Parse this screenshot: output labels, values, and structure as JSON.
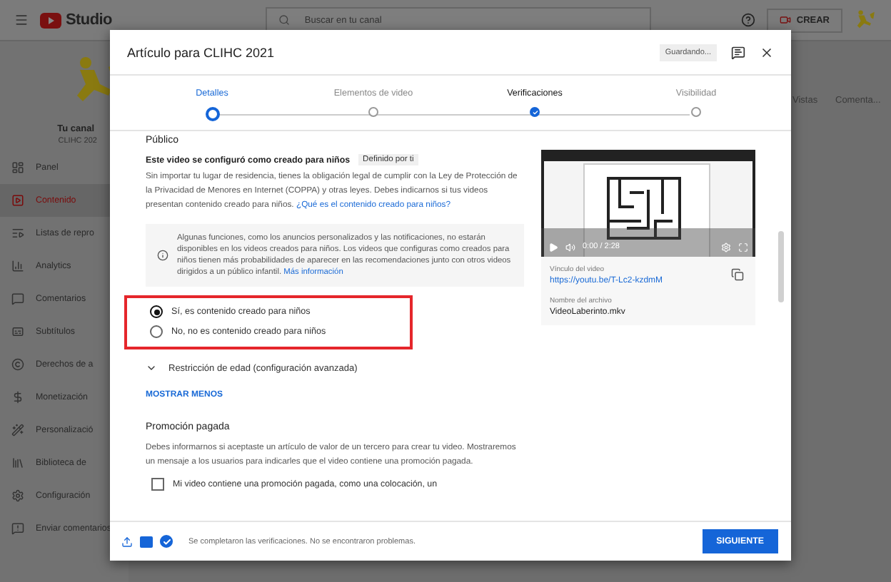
{
  "header": {
    "logo": "Studio",
    "search": {
      "placeholder": "Buscar en tu canal"
    },
    "create_button": "CREAR"
  },
  "sidebar": {
    "title": "Tu canal",
    "channel": "CLIHC  202",
    "items": [
      {
        "label": "Panel",
        "selected": false
      },
      {
        "label": "Contenido",
        "selected": true
      },
      {
        "label": "Listas de repro",
        "selected": false
      },
      {
        "label": "Analytics",
        "selected": false
      },
      {
        "label": "Comentarios",
        "selected": false
      },
      {
        "label": "Subtítulos",
        "selected": false
      },
      {
        "label": "Derechos de a",
        "selected": false
      },
      {
        "label": "Monetización",
        "selected": false
      },
      {
        "label": "Personalizació",
        "selected": false
      },
      {
        "label": "Biblioteca de",
        "selected": false
      },
      {
        "label": "Configuración",
        "selected": false
      },
      {
        "label": "Enviar comentarios",
        "selected": false
      }
    ]
  },
  "table": {
    "columns": [
      "Vistas",
      "Comenta..."
    ]
  },
  "dialog": {
    "title": "Artículo para CLIHC 2021",
    "save_status": "Guardando...",
    "steps": [
      {
        "label": "Detalles",
        "selected": true,
        "done": false
      },
      {
        "label": "Elementos de video",
        "selected": false,
        "done": false
      },
      {
        "label": "Verificaciones",
        "selected": false,
        "done": true
      },
      {
        "label": "Visibilidad",
        "selected": false,
        "done": false
      }
    ],
    "audience": {
      "heading": "Público",
      "subheading": "Este video se configuró como creado para niños",
      "chip": "Definido por ti",
      "description": "Sin importar tu lugar de residencia, tienes la obligación legal de cumplir con la Ley de Protección de la Privacidad de Menores en Internet (COPPA) y otras leyes. Debes indicarnos si tus videos presentan contenido creado para niños.",
      "description_link": "¿Qué es el contenido creado para niños?",
      "info": "Algunas funciones, como los anuncios personalizados y las notificaciones, no estarán disponibles en los videos creados para niños. Los videos que configuras como creados para niños tienen más probabilidades de aparecer en las recomendaciones junto con otros videos dirigidos a un público infantil.",
      "info_link": "Más información",
      "highlighted": true,
      "options": [
        {
          "label": "Sí, es contenido creado para niños",
          "selected": true
        },
        {
          "label": "No, no es contenido creado para niños",
          "selected": false
        }
      ]
    },
    "age_restriction": {
      "label": "Restricción de edad (configuración avanzada)",
      "expanded": false
    },
    "show_less": "MOSTRAR MENOS",
    "paid_promotion": {
      "heading": "Promoción pagada",
      "text": "Debes informarnos si aceptaste un artículo de valor de un tercero para crear tu video. Mostraremos un mensaje a los usuarios para indicarles que el video contiene una promoción pagada.",
      "checkbox": {
        "label": "Mi video contiene una promoción pagada, como una colocación, un",
        "checked": false
      }
    },
    "video": {
      "time": "0:00 / 2:28",
      "link_label": "Vínculo del video",
      "link": "https://youtu.be/T-Lc2-kzdmM",
      "file_label": "Nombre del archivo",
      "file": "VideoLaberinto.mkv"
    },
    "footer": {
      "status": "Se completaron las verificaciones. No se encontraron problemas.",
      "next_button": "SIGUIENTE"
    }
  }
}
